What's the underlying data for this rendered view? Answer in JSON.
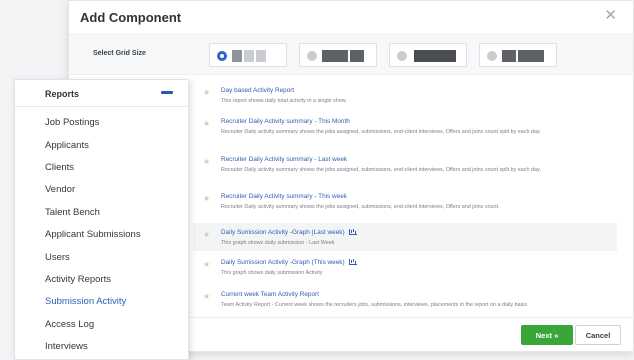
{
  "modal": {
    "title": "Add Component",
    "grid_size_label": "Select Grid Size",
    "grid_options": [
      {
        "selected": true
      },
      {
        "selected": false
      },
      {
        "selected": false
      },
      {
        "selected": false
      }
    ],
    "next_label": "Next »",
    "cancel_label": "Cancel"
  },
  "reports": [
    {
      "title": "Day based Activity Report",
      "desc": "This report shows daily total activity in a single show.",
      "graph": false,
      "checked": false
    },
    {
      "title": "Recruiter Daily Activity summary - This Month",
      "desc": "Recruiter Daily activity summary shows the jobs assigned, submissions, end-client interviews, Offers and joins count split by each day.",
      "graph": false,
      "checked": false
    },
    {
      "title": "Recruiter Daily Activity summary - Last week",
      "desc": "Recruiter Daily activity summary shows the jobs assigned, submissions, end-client interviews, Offers and joins count split by each day.",
      "graph": false,
      "checked": false
    },
    {
      "title": "Recruiter Daily Activity summary - This week",
      "desc": "Recruiter Daily activity summary shows the jobs assigned, submissions, end-client interviews, Offers and joins count.",
      "graph": false,
      "checked": false
    },
    {
      "title": "Daily Sumission Activity -Graph (Last week)",
      "desc": "This graph shows daily submission - Last Week",
      "graph": true,
      "checked": true
    },
    {
      "title": "Daily Sumission Activity -Graph (This week)",
      "desc": "This graph shows daily submission Activity",
      "graph": true,
      "checked": false
    },
    {
      "title": "Current week Team Activity Report",
      "desc": "Team Activity Report - Current week shows the recruiters jobs, submissions, interviews, placements in the report on a daily basis",
      "graph": false,
      "checked": false
    }
  ],
  "menu": {
    "title": "Reports",
    "items": [
      {
        "label": "Job Postings",
        "active": false
      },
      {
        "label": "Applicants",
        "active": false
      },
      {
        "label": "Clients",
        "active": false
      },
      {
        "label": "Vendor",
        "active": false
      },
      {
        "label": "Talent Bench",
        "active": false
      },
      {
        "label": "Applicant Submissions",
        "active": false
      },
      {
        "label": "Users",
        "active": false
      },
      {
        "label": "Activity Reports",
        "active": false
      },
      {
        "label": "Submission Activity",
        "active": true
      },
      {
        "label": "Access Log",
        "active": false
      },
      {
        "label": "Interviews",
        "active": false
      }
    ]
  },
  "colors": {
    "accent": "#2f5fb3",
    "primary_button": "#3aa63a",
    "check": "#3bab3c"
  },
  "icons": {
    "close": "close-icon",
    "star": "star-icon",
    "graph": "graph-icon",
    "check": "check-circle-icon",
    "collapse": "collapse-dash-icon"
  }
}
